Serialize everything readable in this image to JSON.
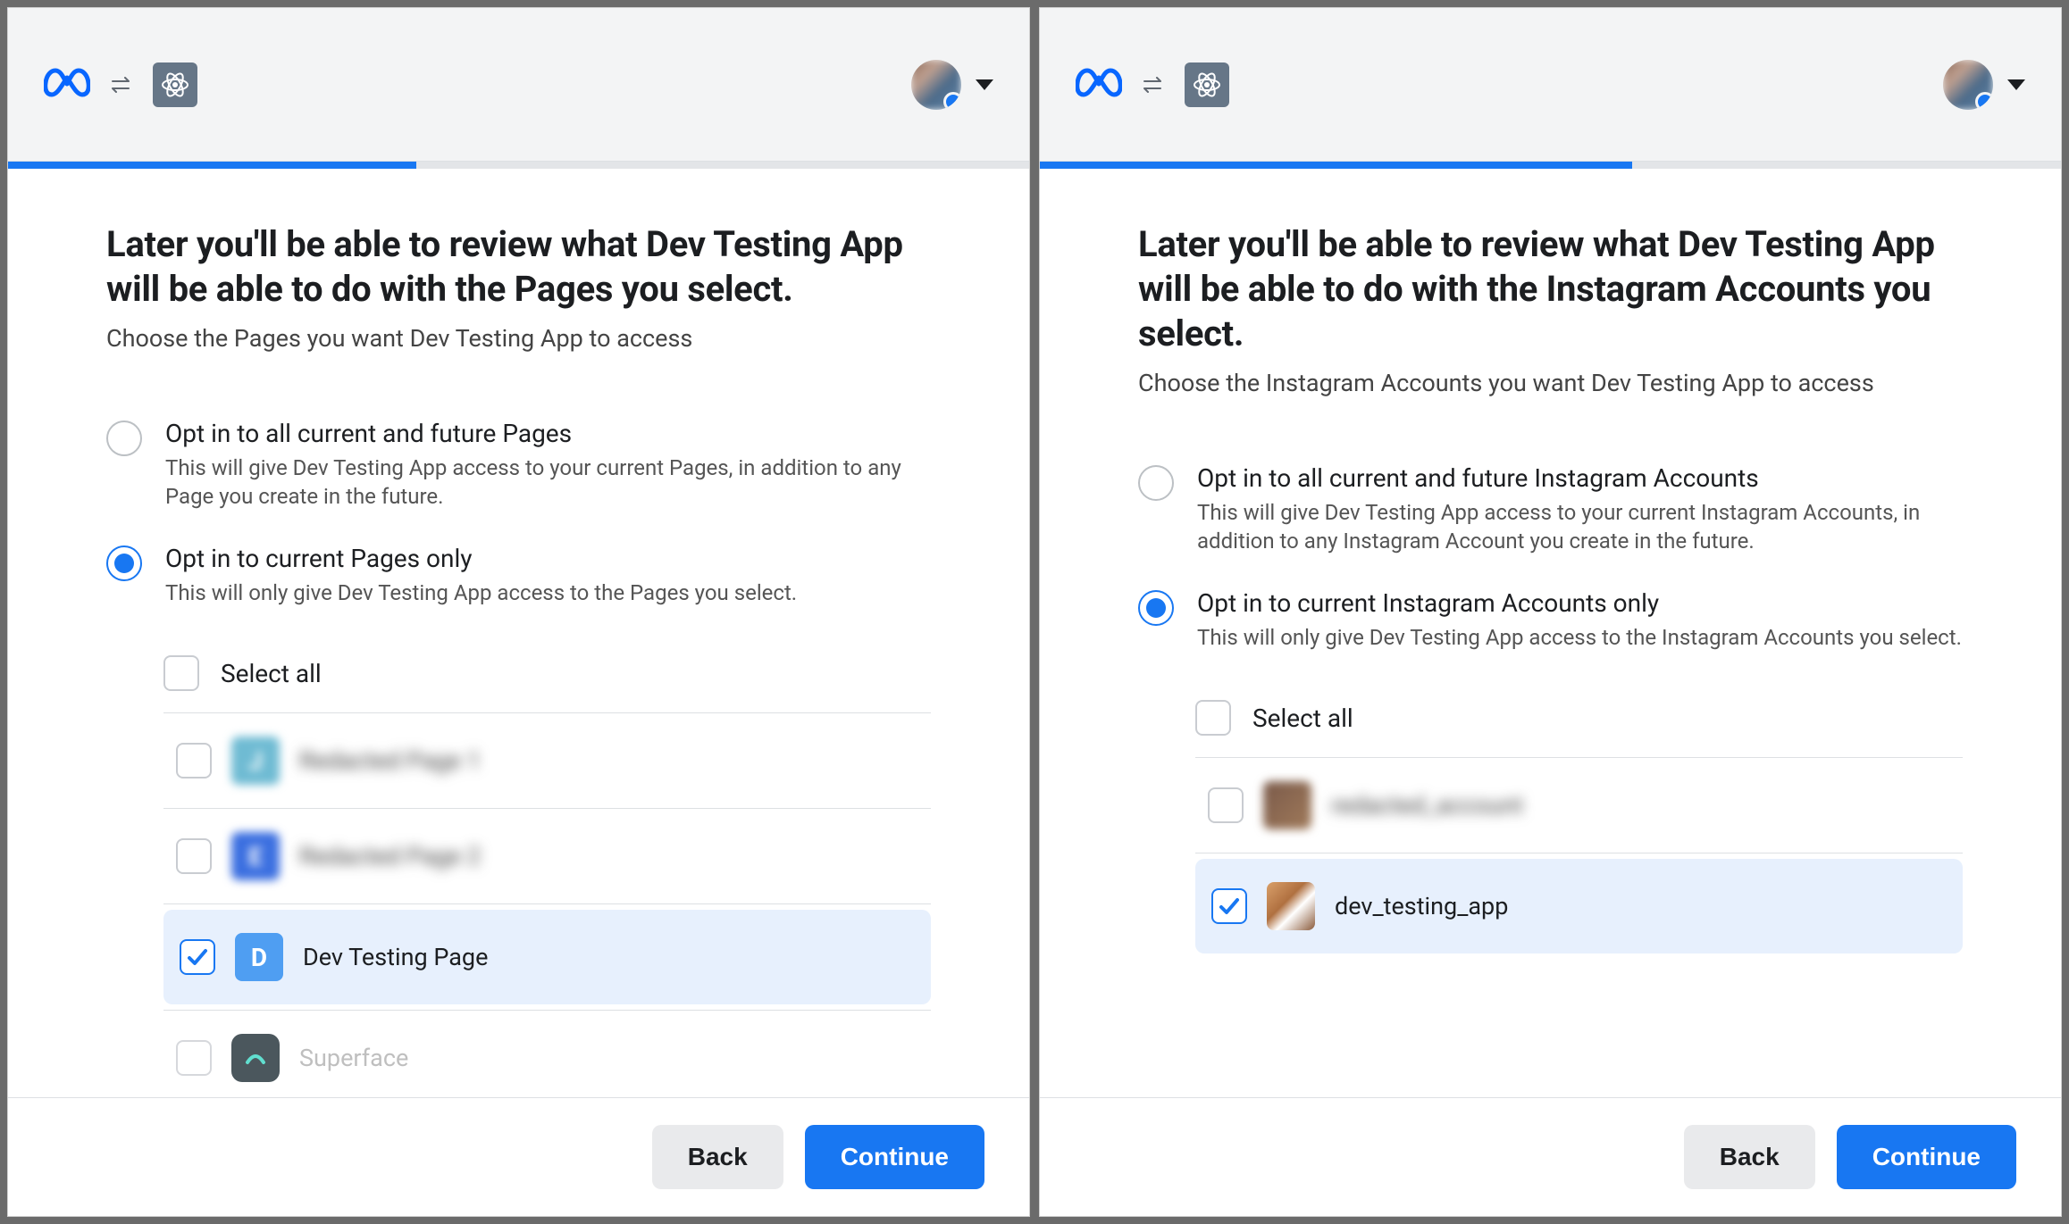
{
  "colors": {
    "accent": "#1877f2"
  },
  "panels": [
    {
      "progress_pct": 40,
      "title": "Later you'll be able to review what Dev Testing App will be able to do with the Pages you select.",
      "subtitle": "Choose the Pages you want Dev Testing App to access",
      "options": {
        "opt_all_label": "Opt in to all current and future Pages",
        "opt_all_desc": "This will give Dev Testing App access to your current Pages, in addition to any Page you create in the future.",
        "opt_current_label": "Opt in to current Pages only",
        "opt_current_desc": "This will only give Dev Testing App access to the Pages you select.",
        "selected": "current"
      },
      "select_all_label": "Select all",
      "items": [
        {
          "label": "Redacted Page 1",
          "selected": false,
          "redacted": true,
          "icon_letter": "J",
          "icon_bg": "#6fbbd3",
          "shape": "square"
        },
        {
          "label": "Redacted Page 2",
          "selected": false,
          "redacted": true,
          "icon_letter": "E",
          "icon_bg": "#3b6fe0",
          "shape": "square"
        },
        {
          "label": "Dev Testing Page",
          "selected": true,
          "redacted": false,
          "icon_letter": "D",
          "icon_bg": "#4f9ef2",
          "shape": "square"
        },
        {
          "label": "Superface",
          "selected": false,
          "redacted": false,
          "partial": true,
          "icon_letter": "",
          "icon_bg": "#102028",
          "shape": "square"
        }
      ],
      "footer": {
        "back": "Back",
        "continue": "Continue"
      }
    },
    {
      "progress_pct": 58,
      "title": "Later you'll be able to review what Dev Testing App will be able to do with the Instagram Accounts you select.",
      "subtitle": "Choose the Instagram Accounts you want Dev Testing App to access",
      "options": {
        "opt_all_label": "Opt in to all current and future Instagram Accounts",
        "opt_all_desc": "This will give Dev Testing App access to your current Instagram Accounts, in addition to any Instagram Account you create in the future.",
        "opt_current_label": "Opt in to current Instagram Accounts only",
        "opt_current_desc": "This will only give Dev Testing App access to the Instagram Accounts you select.",
        "selected": "current"
      },
      "select_all_label": "Select all",
      "items": [
        {
          "label": "redacted_account",
          "selected": false,
          "redacted": true,
          "icon_bg": "#7a5a4a",
          "shape": "square"
        },
        {
          "label": "dev_testing_app",
          "selected": true,
          "redacted": false,
          "icon_bg": "#c08050",
          "shape": "square",
          "cat": true
        }
      ],
      "footer": {
        "back": "Back",
        "continue": "Continue"
      }
    }
  ]
}
